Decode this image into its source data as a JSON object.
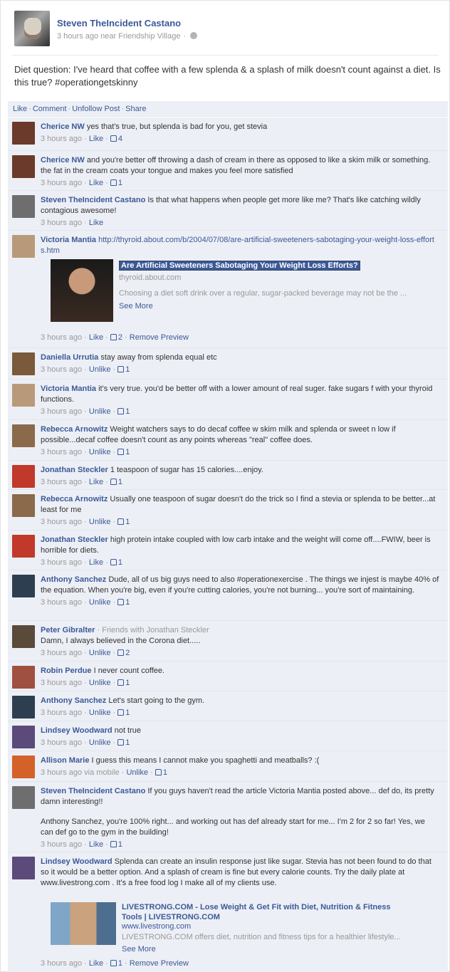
{
  "post": {
    "author": "Steven TheIncident Castano",
    "meta": "3 hours ago near Friendship Village",
    "status": "Diet question: I've heard that coffee with a few splenda & a splash of milk doesn't count against a diet. Is this true? #operationgetskinny",
    "actions": [
      "Like",
      "Comment",
      "Unfollow Post",
      "Share"
    ]
  },
  "comments": [
    {
      "name": "Cherice NW",
      "text": "yes that's true, but splenda is bad for you, get stevia",
      "time": "3 hours ago",
      "action": "Like",
      "likes": "4"
    },
    {
      "name": "Cherice NW",
      "text": "and you're better off throwing a dash of cream in there as opposed to like a skim milk or something. the fat in the cream coats your tongue and makes you feel more satisfied",
      "time": "3 hours ago",
      "action": "Like",
      "likes": "1"
    },
    {
      "name": "Steven TheIncident Castano",
      "text": "Is that what happens when people get more like me? That's like catching wildly contagious awesome!",
      "time": "3 hours ago",
      "action": "Like",
      "likes": ""
    },
    {
      "name": "Victoria Mantia",
      "text": "http://thyroid.about.com/b/2004/07/08/are-artificial-sweeteners-sabotaging-your-weight-loss-efforts.htm",
      "time": "3 hours ago",
      "action": "Like",
      "likes": "2",
      "extra": "Remove Preview"
    },
    {
      "name": "Daniella Urrutia",
      "text": "stay away from splenda equal etc",
      "time": "3 hours ago",
      "action": "Unlike",
      "likes": "1"
    },
    {
      "name": "Victoria Mantia",
      "text": "it's very true. you'd be better off with a lower amount of real suger. fake sugars f with your thyroid functions.",
      "time": "3 hours ago",
      "action": "Unlike",
      "likes": "1"
    },
    {
      "name": "Rebecca Arnowitz",
      "text": "Weight watchers says to do decaf coffee w skim milk and splenda or sweet n low if possible...decaf coffee doesn't count as any points whereas \"real\" coffee does.",
      "time": "3 hours ago",
      "action": "Unlike",
      "likes": "1"
    },
    {
      "name": "Jonathan Steckler",
      "text": "1 teaspoon of sugar has 15 calories....enjoy.",
      "time": "3 hours ago",
      "action": "Like",
      "likes": "1"
    },
    {
      "name": "Rebecca Arnowitz",
      "text": "Usually one teaspoon of sugar doesn't do the trick so I find a stevia or splenda to be better...at least for me",
      "time": "3 hours ago",
      "action": "Unlike",
      "likes": "1"
    },
    {
      "name": "Jonathan Steckler",
      "text": "high protein intake coupled with low carb intake and the weight will come off....FWIW, beer is horrible for diets.",
      "time": "3 hours ago",
      "action": "Like",
      "likes": "1"
    },
    {
      "name": "Anthony Sanchez",
      "text": "Dude, all of us big guys need to also #operationexercise . The things we injest is maybe 40% of the equation. When you're big, even if you're cutting calories, you're not burning... you're sort of maintaining.",
      "time": "3 hours ago",
      "action": "Unlike",
      "likes": "1"
    },
    {
      "name": "Peter Gibralter",
      "friends": "Friends with Jonathan Steckler",
      "text": "Damn, I always believed in the Corona diet.....",
      "time": "3 hours ago",
      "action": "Unlike",
      "likes": "2"
    },
    {
      "name": "Robin Perdue",
      "text": "I never count coffee.",
      "time": "3 hours ago",
      "action": "Unlike",
      "likes": "1"
    },
    {
      "name": "Anthony Sanchez",
      "text": "Let's start going to the gym.",
      "time": "3 hours ago",
      "action": "Unlike",
      "likes": "1"
    },
    {
      "name": "Lindsey Woodward",
      "text": "not true",
      "time": "3 hours ago",
      "action": "Unlike",
      "likes": "1"
    },
    {
      "name": "Allison Marie",
      "text": "I guess this means I cannot make you spaghetti and meatballs? :(",
      "time": "3 hours ago via mobile",
      "action": "Unlike",
      "likes": "1"
    },
    {
      "name": "Steven TheIncident Castano",
      "text": "If you guys haven't read the article Victoria Mantia posted above... def do, its pretty damn interesting!!",
      "text2": "Anthony Sanchez, you're 100% right... and working out has def already start for me... I'm 2 for 2 so far! Yes, we can def go to the gym in the building!",
      "time": "3 hours ago",
      "action": "Like",
      "likes": "1"
    },
    {
      "name": "Lindsey Woodward",
      "text": "Splenda can create an insulin response just like sugar. Stevia has not been found to do that so it would be a better option. And a splash of cream is fine but every calorie counts. Try the daily plate at www.livestrong.com . It's a free food log I make all of my clients use.",
      "time": "3 hours ago",
      "action": "Like",
      "likes": "1",
      "extra": "Remove Preview"
    }
  ],
  "preview1": {
    "title": "Are Artificial Sweeteners Sabotaging Your Weight Loss Efforts?",
    "domain": "thyroid.about.com",
    "desc": "Choosing a diet soft drink over a regular, sugar-packed beverage may not be the ...",
    "more": "See More"
  },
  "preview2": {
    "title": "LIVESTRONG.COM - Lose Weight & Get Fit with Diet, Nutrition & Fitness Tools | LIVESTRONG.COM",
    "domain": "www.livestrong.com",
    "desc": "LIVESTRONG.COM offers diet, nutrition and fitness tips for a healthier lifestyle...",
    "more": "See More"
  },
  "avatar_colors": [
    "#6b3a2a",
    "#6b3a2a",
    "#6e6e6e",
    "#b89a7a",
    "#7a5a3a",
    "#b89a7a",
    "#8a6a4a",
    "#c0392b",
    "#8a6a4a",
    "#c0392b",
    "#2c3e50",
    "#5a4a3a",
    "#a05040",
    "#2c3e50",
    "#5b4a7a",
    "#d4602a",
    "#6e6e6e",
    "#5b4a7a"
  ]
}
